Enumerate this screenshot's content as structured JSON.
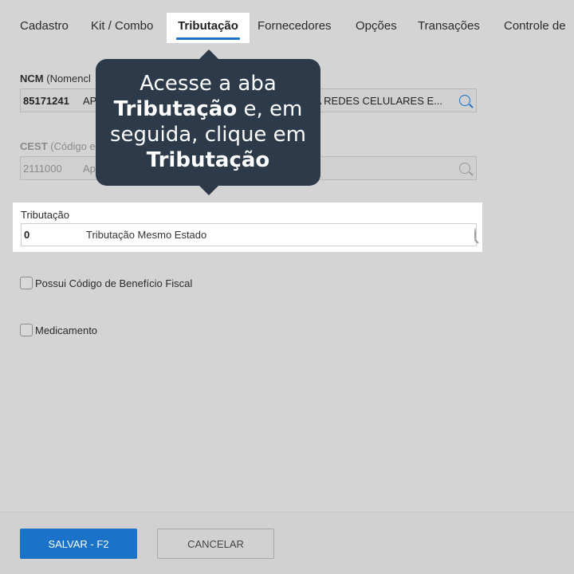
{
  "tabs": {
    "cadastro": "Cadastro",
    "kit_combo": "Kit / Combo",
    "tributacao": "Tributação",
    "fornecedores": "Fornecedores",
    "opcoes": "Opções",
    "transacoes": "Transações",
    "controle": "Controle de"
  },
  "ncm": {
    "label_bold": "NCM",
    "label_rest": "(Nomencl",
    "code": "85171241",
    "desc_left": "AP",
    "desc_right": "A REDES CELULARES E..."
  },
  "cest": {
    "label_bold": "CEST",
    "label_rest": "(Código e",
    "code": "2111000",
    "desc_left": "Ap"
  },
  "tributacao_field": {
    "label": "Tributação",
    "code": "0",
    "desc": "Tributação Mesmo Estado"
  },
  "checkboxes": {
    "beneficio": "Possui Código de Benefício Fiscal",
    "medicamento": "Medicamento"
  },
  "tooltip": {
    "line1": "Acesse a aba",
    "bold1": "Tributação",
    "line2_rest": "e, em",
    "line3": "seguida, clique em",
    "bold2": "Tributação"
  },
  "footer": {
    "save": "SALVAR - F2",
    "cancel": "CANCELAR"
  },
  "colors": {
    "accent": "#1a73c9",
    "tooltip_bg": "#2c3a4a",
    "overlay_bg": "#d4d4d4"
  }
}
